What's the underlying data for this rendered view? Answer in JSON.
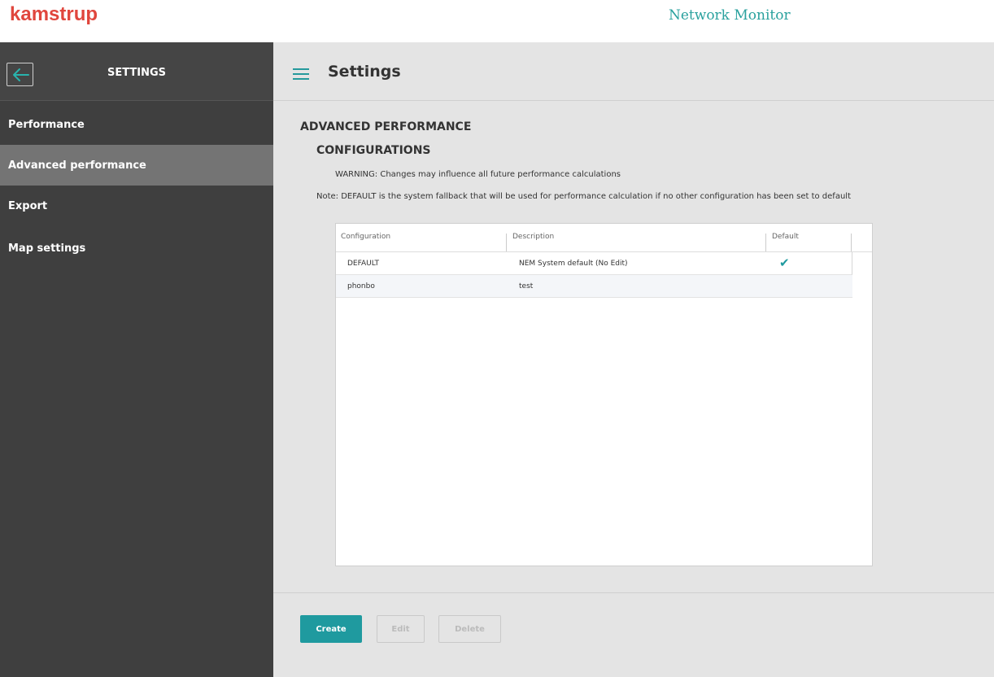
{
  "brand": {
    "logo": "kamstrup",
    "app_title": "Network Monitor"
  },
  "sidebar": {
    "title": "SETTINGS",
    "items": [
      {
        "label": "Performance",
        "active": false
      },
      {
        "label": "Advanced performance",
        "active": true
      },
      {
        "label": "Export",
        "active": false
      },
      {
        "label": "Map settings",
        "active": false
      }
    ]
  },
  "main": {
    "title": "Settings",
    "section_title": "ADVANCED PERFORMANCE",
    "sub_title": "CONFIGURATIONS",
    "warning": "WARNING: Changes may influence all future performance calculations",
    "note": "Note: DEFAULT is the system fallback that will be used for performance calculation if no other configuration has been set to default"
  },
  "table": {
    "columns": [
      "Configuration",
      "Description",
      "Default"
    ],
    "rows": [
      {
        "configuration": "DEFAULT",
        "description": "NEM System default (No Edit)",
        "default": "✔"
      },
      {
        "configuration": "phonbo",
        "description": "test",
        "default": ""
      }
    ]
  },
  "buttons": {
    "create": "Create",
    "edit": "Edit",
    "delete": "Delete"
  },
  "colors": {
    "accent": "#1f9a9f",
    "brand": "#e0463d",
    "sidebar": "#3f3f3f",
    "sidebar_active": "#747474"
  }
}
